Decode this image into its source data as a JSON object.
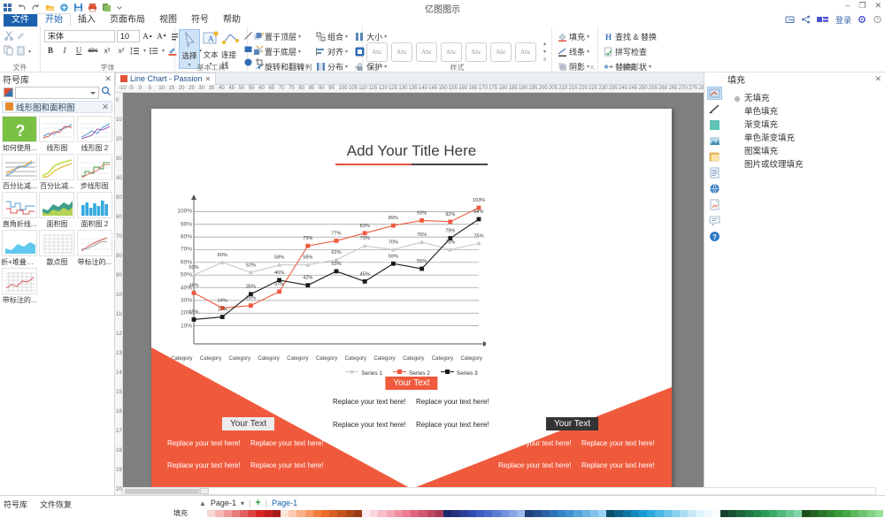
{
  "app": {
    "title": "亿图图示",
    "window_buttons": [
      "–",
      "❐",
      "✕"
    ],
    "quick_access": [
      "menu-icon",
      "undo-icon",
      "redo-icon",
      "open-icon",
      "new-icon",
      "save-icon",
      "print-icon",
      "export-icon",
      "customize-icon"
    ],
    "top_right_actions": [
      "cloud-icon",
      "share-icon",
      "account-icon",
      "登录",
      "settings-icon",
      "help-icon"
    ]
  },
  "ribbon": {
    "tabs": [
      {
        "label": "文件",
        "type": "file"
      },
      {
        "label": "开始",
        "type": "active"
      },
      {
        "label": "插入",
        "type": "normal"
      },
      {
        "label": "页面布局",
        "type": "normal"
      },
      {
        "label": "视图",
        "type": "normal"
      },
      {
        "label": "符号",
        "type": "normal"
      },
      {
        "label": "帮助",
        "type": "normal"
      }
    ],
    "groups": [
      {
        "name": "剪贴板",
        "label": "文件",
        "items": [
          "剪切",
          "复制",
          "格式刷",
          "粘贴"
        ]
      },
      {
        "name": "字体",
        "label": "字体",
        "font_name": "宋体",
        "font_size": "10",
        "buttons": [
          "A↑",
          "A↓",
          "清除格式",
          "B",
          "I",
          "U",
          "abc",
          "x₂",
          "x²",
          "行距",
          "项目符号",
          "文本高亮",
          "字体颜色"
        ]
      },
      {
        "name": "基本工具",
        "label": "基本工具",
        "tools": [
          {
            "label": "选择",
            "icon": "cursor-icon",
            "selected": true
          },
          {
            "label": "文本",
            "icon": "text-icon",
            "selected": false
          },
          {
            "label": "连接线",
            "icon": "connector-icon",
            "selected": false
          }
        ],
        "side_icons": [
          "line-icon",
          "curve-icon",
          "rectangle-icon",
          "close-shape-icon",
          "ellipse-icon",
          "crop-icon"
        ]
      },
      {
        "name": "排列",
        "label": "排列",
        "items": [
          "置于顶层",
          "组合",
          "大小",
          "置于底层",
          "对齐",
          "居中",
          "旋转和翻转",
          "分布",
          "保护"
        ]
      },
      {
        "name": "样式",
        "label": "样式",
        "style_count": 7,
        "style_label": "Abc"
      },
      {
        "name": "填充线条",
        "label": "",
        "items": [
          "填充",
          "线条",
          "阴影"
        ]
      },
      {
        "name": "编辑",
        "label": "编辑",
        "items": [
          "查找 & 替换",
          "拼写检查",
          "替换形状"
        ]
      }
    ]
  },
  "left_panel": {
    "title": "符号库",
    "close_icon": "close-icon",
    "search_placeholder": "",
    "search_icon": "search-icon",
    "library_name": "线形图和面积图",
    "symbols": [
      {
        "label": "如何使用...",
        "thumb": "help-icon"
      },
      {
        "label": "线形图",
        "thumb": "line-chart"
      },
      {
        "label": "线形图 2",
        "thumb": "line-chart-2"
      },
      {
        "label": "百分比减...",
        "thumb": "percent-stacked"
      },
      {
        "label": "百分比减...",
        "thumb": "percent-stacked-2"
      },
      {
        "label": "步线形图",
        "thumb": "step-line"
      },
      {
        "label": "直角折线...",
        "thumb": "right-angle-line"
      },
      {
        "label": "面积图",
        "thumb": "area-chart"
      },
      {
        "label": "面积图 2",
        "thumb": "area-chart-2"
      },
      {
        "label": "折+堆叠积图",
        "thumb": "stacked-area"
      },
      {
        "label": "散点图",
        "thumb": "scatter-chart"
      },
      {
        "label": "带标注的...",
        "thumb": "annotated-line"
      },
      {
        "label": "带标注的...",
        "thumb": "annotated-line-2"
      }
    ]
  },
  "document": {
    "tab_label": "Line Chart - Passion",
    "tab_close": "✕",
    "ruler_h_ticks": [
      "-10",
      "-5",
      "0",
      "5",
      "10",
      "15",
      "20",
      "25",
      "30",
      "35",
      "40",
      "45",
      "50",
      "55",
      "60",
      "65",
      "70",
      "75",
      "80",
      "85",
      "90",
      "95",
      "100",
      "105",
      "110",
      "115",
      "120",
      "125",
      "130",
      "135",
      "140",
      "145",
      "150",
      "155",
      "160",
      "165",
      "170",
      "175",
      "180",
      "185",
      "190",
      "195",
      "200",
      "205",
      "210",
      "215",
      "220",
      "225",
      "230",
      "235",
      "240",
      "245",
      "250",
      "255",
      "260",
      "265",
      "270",
      "275",
      "280"
    ],
    "ruler_v_ticks": [
      "0",
      "10",
      "20",
      "30",
      "40",
      "50",
      "60",
      "70",
      "80",
      "90",
      "100",
      "110",
      "120",
      "130",
      "140",
      "150",
      "160",
      "170",
      "180",
      "190",
      "200"
    ]
  },
  "slide": {
    "title": "Add Your Title Here",
    "badges": [
      {
        "id": "badge-center",
        "label": "Your Text",
        "style": "red"
      },
      {
        "id": "badge-left",
        "label": "Your Text",
        "style": "gray"
      },
      {
        "id": "badge-right",
        "label": "Your Text",
        "style": "dark"
      }
    ],
    "placeholder_text": "Replace your text here!",
    "center_texts": [
      "Replace your text here!",
      "Replace your text here!",
      "Replace your text here!",
      "Replace your text here!"
    ],
    "left_texts": [
      "Replace your text here!",
      "Replace your text here!",
      "Replace your text here!",
      "Replace your text here!"
    ],
    "right_texts": [
      "Replace your text here!",
      "Replace your text here!",
      "Replace your text here!",
      "Replace your text here!"
    ],
    "accent_color": "#f05a3c"
  },
  "chart_data": {
    "type": "line",
    "title": "Add Your Title Here",
    "xlabel": "",
    "ylabel": "",
    "ylim": [
      0,
      110
    ],
    "ytick_labels": [
      "10%",
      "20%",
      "30%",
      "40%",
      "50%",
      "60%",
      "70%",
      "80%",
      "90%",
      "100%"
    ],
    "yticks": [
      10,
      20,
      30,
      40,
      50,
      60,
      70,
      80,
      90,
      100
    ],
    "grid": true,
    "legend_position": "bottom",
    "categories": [
      "Category",
      "Category",
      "Category",
      "Category",
      "Category",
      "Category",
      "Category",
      "Category",
      "Category",
      "Category",
      "Category"
    ],
    "series": [
      {
        "name": "Series 1",
        "color": "#c8c8c8",
        "marker": "triangle",
        "values": [
          50,
          60,
          52,
          58,
          58,
          62,
          73,
          70,
          76,
          70,
          75
        ],
        "labels": [
          "50%",
          "60%",
          "52%",
          "58%",
          "58%",
          "62%",
          "73%",
          "70%",
          "76%",
          "70%",
          "75%"
        ]
      },
      {
        "name": "Series 2",
        "color": "#ef5a3d",
        "marker": "square",
        "values": [
          36,
          24,
          26,
          37,
          73,
          77,
          83,
          89,
          93,
          92,
          103
        ],
        "labels": [
          "36%",
          "24%",
          "26%",
          "37%",
          "73%",
          "77%",
          "83%",
          "89%",
          "93%",
          "92%",
          "103%"
        ]
      },
      {
        "name": "Series 3",
        "color": "#1a1a1a",
        "marker": "square",
        "values": [
          15,
          17,
          35,
          46,
          42,
          53,
          45,
          59,
          55,
          79,
          94
        ],
        "labels": [
          "15%",
          "17%",
          "35%",
          "46%",
          "42%",
          "53%",
          "45%",
          "59%",
          "55%",
          "79%",
          "94%"
        ]
      }
    ]
  },
  "right_panel": {
    "title": "填充",
    "close_icon": "close-icon",
    "options": [
      {
        "label": "无填充",
        "selected": true
      },
      {
        "label": "单色填充",
        "selected": false
      },
      {
        "label": "渐变填充",
        "selected": false
      },
      {
        "label": "单色渐变填充",
        "selected": false
      },
      {
        "label": "图案填充",
        "selected": false
      },
      {
        "label": "图片或纹理填充",
        "selected": false
      }
    ],
    "icons": [
      {
        "name": "fill-icon",
        "selected": true
      },
      {
        "name": "line-icon",
        "selected": false
      },
      {
        "name": "shadow-icon",
        "selected": false
      },
      {
        "name": "effects-icon",
        "selected": false
      },
      {
        "name": "page-icon",
        "selected": false
      },
      {
        "name": "data-icon",
        "selected": false
      },
      {
        "name": "globe-icon",
        "selected": false
      },
      {
        "name": "document-icon",
        "selected": false
      },
      {
        "name": "comment-icon",
        "selected": false
      },
      {
        "name": "help-icon",
        "selected": false
      }
    ]
  },
  "status_bar": {
    "tabs": [
      "符号库",
      "文件恢复"
    ],
    "page_nav_icon": "chevron-up-icon",
    "page_name": "Page-1",
    "page_dropdown": "▾",
    "add_page": "+",
    "active_page": "Page-1",
    "palette_label": "填充"
  }
}
